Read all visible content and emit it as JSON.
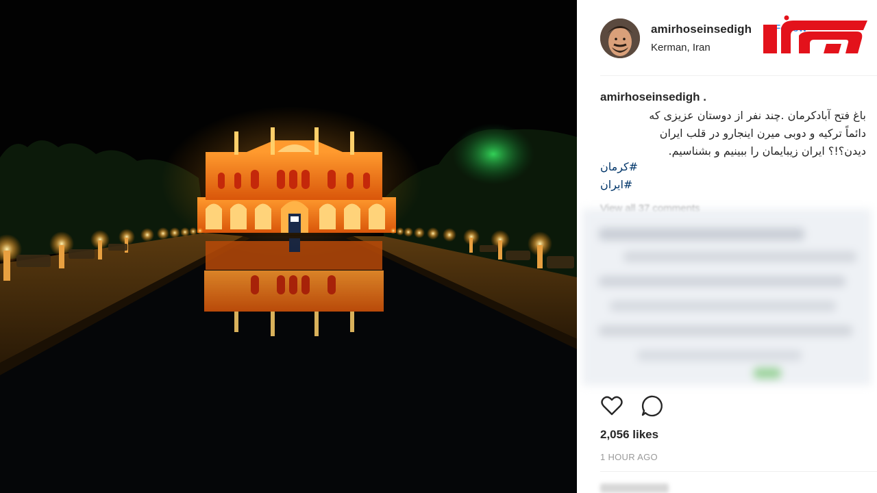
{
  "post": {
    "username": "amirhoseinsedigh",
    "follow_label": "Follow",
    "location": "Kerman, Iran",
    "caption_user": "amirhoseinsedigh .",
    "caption_lines": [
      "باغ فتح آبادکرمان .چند نفر از دوستان عزیزی که",
      "دائماً ترکیه و دوبی میرن اینجارو در قلب ایران",
      "دیدن؟!؟ ایران زیبایمان را ببینیم و بشناسیم."
    ],
    "hashtags": [
      "#کرمان",
      "#ایران"
    ],
    "view_all_comments": "View all 37 comments",
    "likes": "2,056 likes",
    "time_ago": "1 HOUR AGO"
  },
  "icons": {
    "like": "heart-icon",
    "comment": "comment-bubble-icon",
    "logo": "rokna-news-logo"
  },
  "colors": {
    "link_blue": "#3897f0",
    "hashtag_blue": "#003569",
    "logo_red": "#e3121b",
    "text": "#262626",
    "muted": "#999999"
  }
}
